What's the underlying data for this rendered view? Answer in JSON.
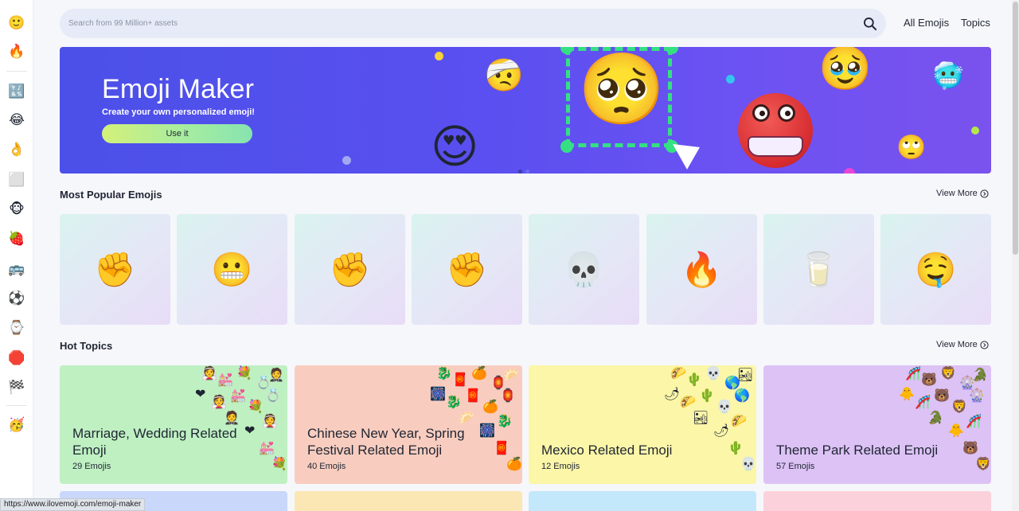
{
  "sidebar": {
    "items": [
      {
        "name": "smileys",
        "glyph": "🙂"
      },
      {
        "name": "trending",
        "glyph": "🔥"
      },
      {
        "name": "symbols-keycap",
        "glyph": "🔣"
      },
      {
        "name": "laughing",
        "glyph": "😂"
      },
      {
        "name": "hand",
        "glyph": "👌"
      },
      {
        "name": "frame",
        "glyph": "⬜"
      },
      {
        "name": "animals",
        "glyph": "🐵"
      },
      {
        "name": "food",
        "glyph": "🍓"
      },
      {
        "name": "travel",
        "glyph": "🚌"
      },
      {
        "name": "activities",
        "glyph": "⚽"
      },
      {
        "name": "objects",
        "glyph": "⌚"
      },
      {
        "name": "symbols",
        "glyph": "🛑"
      },
      {
        "name": "flags",
        "glyph": "🏁"
      },
      {
        "name": "emoji-maker",
        "glyph": "🥳"
      }
    ]
  },
  "search": {
    "placeholder": "Search from 99 Million+ assets",
    "value": ""
  },
  "nav": {
    "all_emojis": "All Emojis",
    "topics": "Topics"
  },
  "banner": {
    "title": "Emoji Maker",
    "subtitle": "Create your own personalized emoji!",
    "button": "Use it"
  },
  "popular": {
    "title": "Most Popular Emojis",
    "view_more": "View More",
    "items": [
      {
        "name": "raised-fist-medium",
        "glyph": "✊"
      },
      {
        "name": "grimacing-face",
        "glyph": "😬"
      },
      {
        "name": "raised-fist-medium-light",
        "glyph": "✊"
      },
      {
        "name": "raised-fist-light",
        "glyph": "✊"
      },
      {
        "name": "skull",
        "glyph": "💀"
      },
      {
        "name": "fire",
        "glyph": "🔥"
      },
      {
        "name": "glass-of-milk",
        "glyph": "🥛"
      },
      {
        "name": "drooling-face",
        "glyph": "🤤"
      }
    ]
  },
  "topics": {
    "title": "Hot Topics",
    "view_more": "View More",
    "items": [
      {
        "title": "Marriage, Wedding Related Emoji",
        "count": "29 Emojis",
        "bg": "#bff0c2",
        "deco": [
          "👰",
          "💒",
          "💐",
          "💍",
          "🤵",
          "❤"
        ]
      },
      {
        "title": "Chinese New Year, Spring Festival Related Emoji",
        "count": "40 Emojis",
        "bg": "#f8cdbf",
        "deco": [
          "🐉",
          "🧧",
          "🍊",
          "🏮",
          "🥟",
          "🎆"
        ]
      },
      {
        "title": "Mexico Related Emoji",
        "count": "12 Emojis",
        "bg": "#fbf6a8",
        "deco": [
          "🌮",
          "🌵",
          "💀",
          "🌎",
          "🏜",
          "🌶"
        ]
      },
      {
        "title": "Theme Park Related Emoji",
        "count": "57 Emojis",
        "bg": "#dcc2f5",
        "deco": [
          "🎢",
          "🐻",
          "🦁",
          "🎡",
          "🐊",
          "🐥"
        ]
      }
    ],
    "bottom_row_bgs": [
      "#c9d7fb",
      "#fbe7b4",
      "#c4e8fb",
      "#fbd2dc"
    ]
  },
  "status_url": "https://www.ilovemoji.com/emoji-maker",
  "colors": {
    "banner_start": "#4b50e8",
    "banner_end": "#7a52ee",
    "button_start": "#d4f07a",
    "button_end": "#86e4b0",
    "search_bg": "#e6ebf7"
  }
}
